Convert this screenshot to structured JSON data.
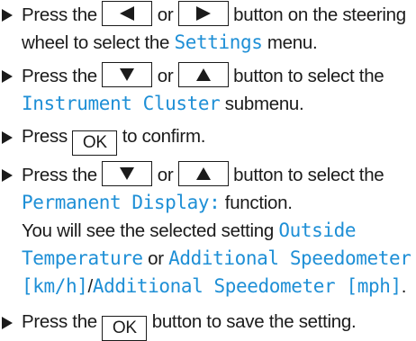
{
  "steps": [
    {
      "before": "Press the",
      "key_left": "left-arrow-key",
      "or": "or",
      "key_right": "right-arrow-key",
      "after": "button on the steering wheel to select the",
      "menu": "Settings",
      "end": "menu."
    },
    {
      "before": "Press the",
      "or": "or",
      "after": "button to select the",
      "submenu": "Instrument Cluster",
      "end": "submenu."
    },
    {
      "before": "Press",
      "key_label": "OK",
      "after": "to confirm."
    },
    {
      "before": "Press the",
      "or": "or",
      "after": "button to select the",
      "function": "Permanent Display:",
      "function_end": "function.",
      "result_before": "You will see the selected setting",
      "option1": "Outside Temperature",
      "or_word": "or",
      "option2": "Additional Speedometer [km/h]",
      "slash": "/",
      "option3": "Additional Speedometer [mph]",
      "end": "."
    },
    {
      "before": "Press the",
      "key_label": "OK",
      "after": "button to save the setting."
    }
  ],
  "colors": {
    "text": "#1b1b1b",
    "highlight": "#1e8fd6"
  },
  "icons": [
    "bullet-arrow-icon",
    "left-arrow-key",
    "right-arrow-key",
    "down-arrow-key",
    "up-arrow-key"
  ]
}
